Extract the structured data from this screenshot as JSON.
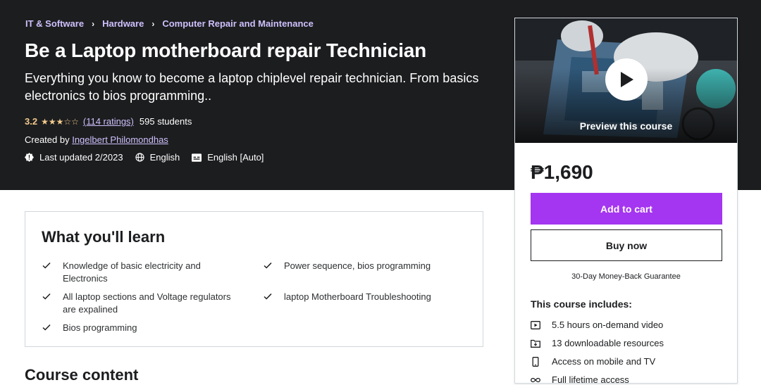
{
  "breadcrumb": [
    "IT & Software",
    "Hardware",
    "Computer Repair and Maintenance"
  ],
  "course": {
    "title": "Be a Laptop motherboard repair Technician",
    "subtitle": "Everything you know to become a laptop chiplevel repair technician. From basics electronics to bios programming..",
    "rating": "3.2",
    "stars": "★★★☆☆",
    "ratings_count": "(114 ratings)",
    "students": "595 students",
    "created_by_label": "Created by",
    "instructor": "Ingelbert Philomondhas",
    "last_updated": "Last updated 2/2023",
    "language": "English",
    "captions": "English [Auto]"
  },
  "learn": {
    "heading": "What you'll learn",
    "items": [
      "Knowledge of basic electricity and Electronics",
      "Power sequence, bios programming",
      "All laptop sections and Voltage regulators are expalined",
      "laptop Motherboard Troubleshooting",
      "Bios programming"
    ]
  },
  "course_content_heading": "Course content",
  "sidebar": {
    "preview_label": "Preview this course",
    "price": "₱1,690",
    "add_to_cart": "Add to cart",
    "buy_now": "Buy now",
    "guarantee": "30-Day Money-Back Guarantee",
    "includes_title": "This course includes:",
    "includes": [
      {
        "icon": "video-icon",
        "text": "5.5 hours on-demand video"
      },
      {
        "icon": "download-icon",
        "text": "13 downloadable resources"
      },
      {
        "icon": "mobile-icon",
        "text": "Access on mobile and TV"
      },
      {
        "icon": "infinity-icon",
        "text": "Full lifetime access"
      }
    ]
  },
  "colors": {
    "hero_bg": "#1c1d1f",
    "link_purple": "#cec0fc",
    "star_gold": "#f3ca8c",
    "cart_purple": "#a435f0"
  }
}
